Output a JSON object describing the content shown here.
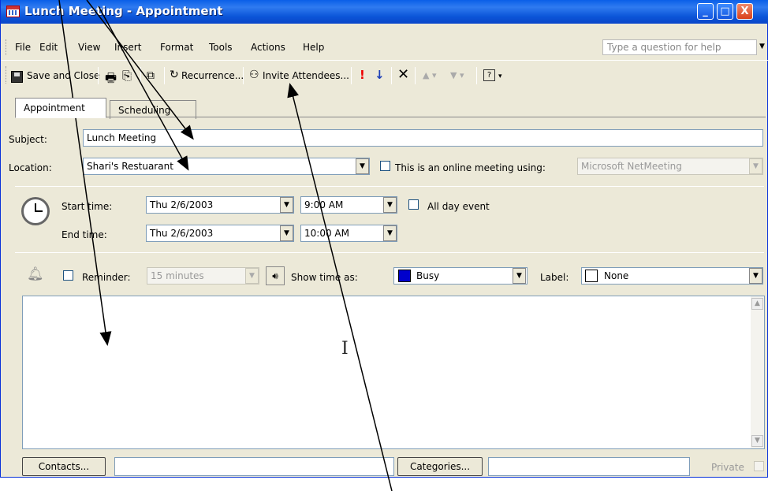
{
  "window": {
    "title": "Lunch Meeting - Appointment",
    "min": "_",
    "max": "□",
    "close": "X"
  },
  "menu": [
    "File",
    "Edit",
    "View",
    "Insert",
    "Format",
    "Tools",
    "Actions",
    "Help"
  ],
  "help_placeholder": "Type a question for help",
  "toolbar": {
    "save_close": "Save and Close",
    "recurrence": "Recurrence...",
    "invite": "Invite Attendees..."
  },
  "tabs": [
    "Appointment",
    "Scheduling"
  ],
  "form": {
    "subject_label": "Subject:",
    "subject_value": "Lunch Meeting",
    "location_label": "Location:",
    "location_value": "Shari's Restuarant",
    "online_label": "This is an online meeting using:",
    "online_value": "Microsoft NetMeeting",
    "start_label": "Start time:",
    "start_date": "Thu 2/6/2003",
    "start_time": "9:00 AM",
    "all_day": "All day event",
    "end_label": "End time:",
    "end_date": "Thu 2/6/2003",
    "end_time": "10:00 AM",
    "reminder_label": "Reminder:",
    "reminder_value": "15 minutes",
    "show_time_label": "Show time as:",
    "show_time_value": "Busy",
    "label_label": "Label:",
    "label_value": "None"
  },
  "footer": {
    "contacts": "Contacts...",
    "categories": "Categories...",
    "private": "Private"
  },
  "colors": {
    "busy": "#0000cc",
    "titlebar": "#0a5fe8"
  }
}
